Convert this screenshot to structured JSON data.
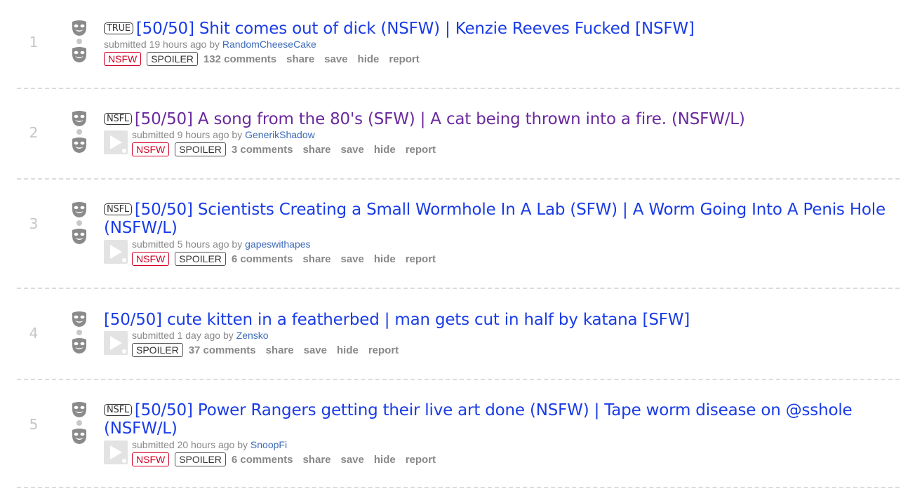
{
  "posts": [
    {
      "rank": "1",
      "flair": "TRUE",
      "title": "[50/50] Shit comes out of dick (NSFW) | Kenzie Reeves Fucked [NSFW]",
      "visited": false,
      "submitted_prefix": "submitted ",
      "time": "19 hours ago",
      "by": " by ",
      "author": "RandomCheeseCake",
      "nsfw_label": "NSFW",
      "spoiler_label": "SPOILER",
      "comments": "132 comments",
      "share": "share",
      "save": "save",
      "hide": "hide",
      "report": "report"
    },
    {
      "rank": "2",
      "flair": "NSFL",
      "title": "[50/50] A song from the 80's (SFW) | A cat being thrown into a fire. (NSFW/L)",
      "visited": true,
      "submitted_prefix": "submitted ",
      "time": "9 hours ago",
      "by": " by ",
      "author": "GenerikShadow",
      "nsfw_label": "NSFW",
      "spoiler_label": "SPOILER",
      "comments": "3 comments",
      "share": "share",
      "save": "save",
      "hide": "hide",
      "report": "report"
    },
    {
      "rank": "3",
      "flair": "NSFL",
      "title": "[50/50] Scientists Creating a Small Wormhole In A Lab (SFW) | A Worm Going Into A Penis Hole (NSFW/L)",
      "visited": false,
      "submitted_prefix": "submitted ",
      "time": "5 hours ago",
      "by": " by ",
      "author": "gapeswithapes",
      "nsfw_label": "NSFW",
      "spoiler_label": "SPOILER",
      "comments": "6 comments",
      "share": "share",
      "save": "save",
      "hide": "hide",
      "report": "report"
    },
    {
      "rank": "4",
      "flair": "",
      "title": "[50/50] cute kitten in a featherbed | man gets cut in half by katana [SFW]",
      "visited": false,
      "submitted_prefix": "submitted ",
      "time": "1 day ago",
      "by": " by ",
      "author": "Zensko",
      "nsfw_label": "",
      "spoiler_label": "SPOILER",
      "comments": "37 comments",
      "share": "share",
      "save": "save",
      "hide": "hide",
      "report": "report"
    },
    {
      "rank": "5",
      "flair": "NSFL",
      "title": "[50/50] Power Rangers getting their live art done (NSFW) | Tape worm disease on @sshole (NSFW/L)",
      "visited": false,
      "submitted_prefix": "submitted ",
      "time": "20 hours ago",
      "by": " by ",
      "author": "SnoopFi",
      "nsfw_label": "NSFW",
      "spoiler_label": "SPOILER",
      "comments": "6 comments",
      "share": "share",
      "save": "save",
      "hide": "hide",
      "report": "report"
    }
  ],
  "icons": {
    "upvote": "upvote-mask-icon",
    "downvote": "downvote-mask-icon",
    "thumbnail": "video-thumbnail-icon"
  },
  "colors": {
    "link": "#1a3ce6",
    "visited": "#6a2a9e",
    "nsfw": "#d10023",
    "author": "#3d6bb8",
    "meta": "#888888"
  }
}
